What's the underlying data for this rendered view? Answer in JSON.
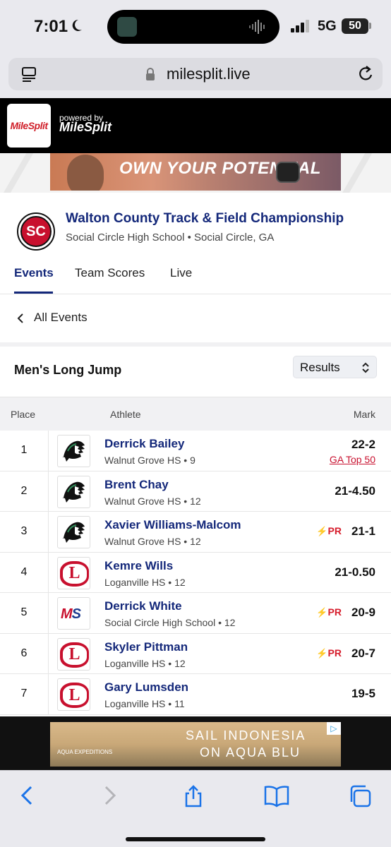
{
  "status_bar": {
    "time": "7:01",
    "network": "5G",
    "battery": "50"
  },
  "browser": {
    "url": "milesplit.live"
  },
  "header": {
    "logo_text": "MileSplit",
    "powered_by": "powered by",
    "powered_brand": "MileSplit"
  },
  "ad_top": {
    "text": "OWN YOUR POTENTIAL"
  },
  "meet": {
    "logo_text": "SC",
    "title": "Walton County Track & Field Championship",
    "subtitle": "Social Circle High School • Social Circle, GA"
  },
  "tabs": [
    {
      "label": "Events",
      "active": true
    },
    {
      "label": "Team Scores",
      "active": false
    },
    {
      "label": "Live",
      "active": false
    }
  ],
  "nav": {
    "all_events": "All Events"
  },
  "event": {
    "name": "Men's Long Jump",
    "view_select": "Results"
  },
  "table": {
    "headers": {
      "place": "Place",
      "athlete": "Athlete",
      "mark": "Mark"
    },
    "rows": [
      {
        "place": "1",
        "name": "Derrick Bailey",
        "team": "Walnut Grove HS • 9",
        "mark": "22-2",
        "badge": "GA Top 50",
        "pr": "",
        "logo": "walnut-grove-warrior"
      },
      {
        "place": "2",
        "name": "Brent Chay",
        "team": "Walnut Grove HS • 12",
        "mark": "21-4.50",
        "badge": "",
        "pr": "",
        "logo": "walnut-grove-warrior"
      },
      {
        "place": "3",
        "name": "Xavier Williams-Malcom",
        "team": "Walnut Grove HS • 12",
        "mark": "21-1",
        "badge": "",
        "pr": "PR",
        "logo": "walnut-grove-warrior"
      },
      {
        "place": "4",
        "name": "Kemre Wills",
        "team": "Loganville HS • 12",
        "mark": "21-0.50",
        "badge": "",
        "pr": "",
        "logo": "loganville-l"
      },
      {
        "place": "5",
        "name": "Derrick White",
        "team": "Social Circle High School • 12",
        "mark": "20-9",
        "badge": "",
        "pr": "PR",
        "logo": "milesplit-ms"
      },
      {
        "place": "6",
        "name": "Skyler Pittman",
        "team": "Loganville HS • 12",
        "mark": "20-7",
        "badge": "",
        "pr": "PR",
        "logo": "loganville-l"
      },
      {
        "place": "7",
        "name": "Gary Lumsden",
        "team": "Loganville HS • 11",
        "mark": "19-5",
        "badge": "",
        "pr": "",
        "logo": "loganville-l"
      }
    ]
  },
  "ad_bottom": {
    "line1": "SAIL INDONESIA",
    "line2": "ON AQUA BLU",
    "brand": "AQUA EXPEDITIONS"
  },
  "logo_letters": {
    "loganville": "L",
    "ms_m": "M",
    "ms_s": "S"
  },
  "colors": {
    "navy": "#14287a",
    "red": "#c8102e",
    "ios_blue": "#1a73e8"
  }
}
